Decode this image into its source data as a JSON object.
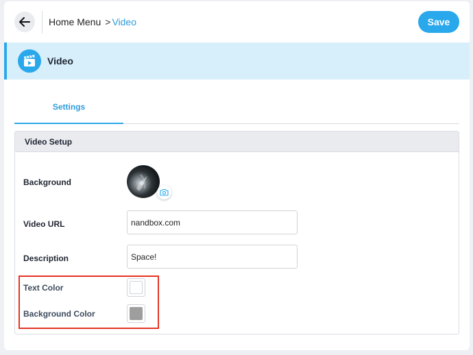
{
  "header": {
    "breadcrumb_home": "Home Menu",
    "breadcrumb_separator": ">",
    "breadcrumb_current": "Video",
    "save_label": "Save"
  },
  "section": {
    "title": "Video",
    "icon": "video-clapperboard-icon"
  },
  "tabs": [
    {
      "label": "Settings",
      "active": true
    }
  ],
  "panel": {
    "title": "Video Setup",
    "fields": {
      "background": {
        "label": "Background"
      },
      "video_url": {
        "label": "Video URL",
        "value": "nandbox.com"
      },
      "description": {
        "label": "Description",
        "value": "Space!"
      },
      "text_color": {
        "label": "Text Color",
        "color": "#ffffff"
      },
      "background_color": {
        "label": "Background Color",
        "color": "#9e9e9e"
      }
    }
  },
  "colors": {
    "accent": "#2aa8ec",
    "header_bg": "#d7eefb",
    "highlight": "#e53323"
  }
}
